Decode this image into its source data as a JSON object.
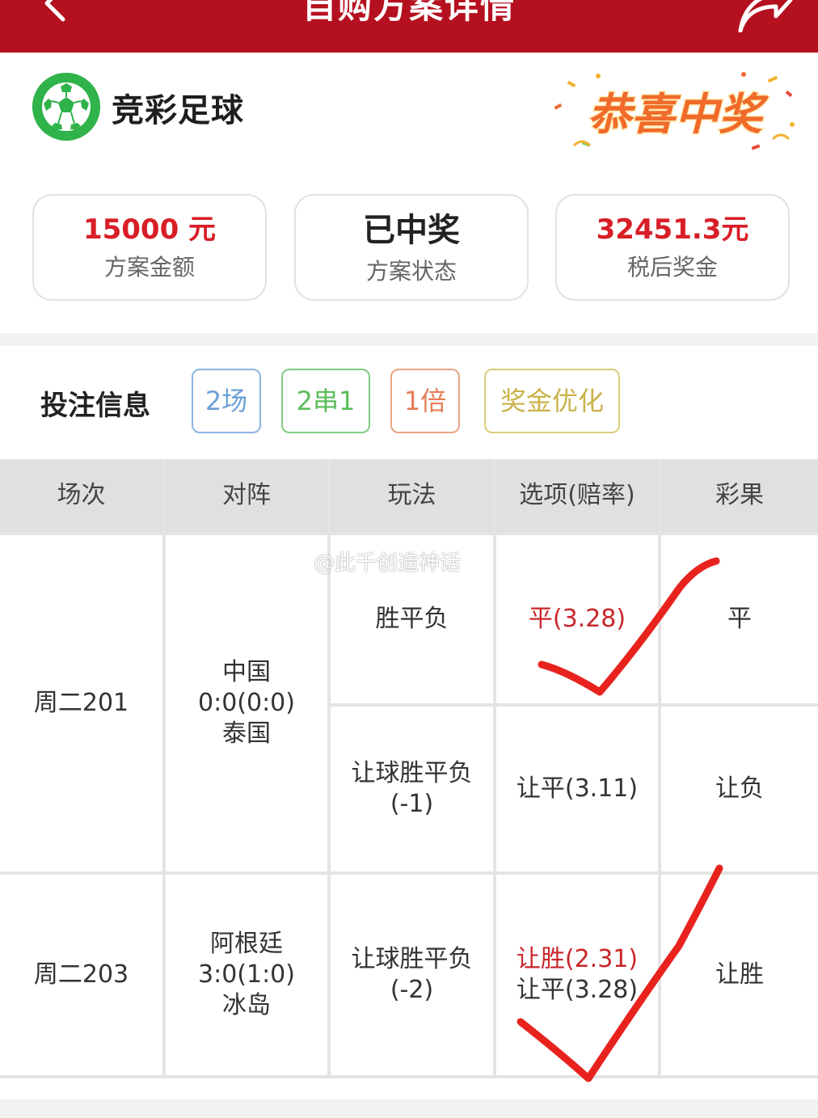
{
  "header": {
    "title": "自购方案详情",
    "back_icon": "chevron-left-icon",
    "share_icon": "share-arrow-icon",
    "background_color": "#b5101f"
  },
  "lottery": {
    "name": "竞彩足球",
    "logo_icon": "soccer-ball-icon",
    "logo_color": "#2fb34a",
    "banner_text": "恭喜中奖"
  },
  "summary": {
    "amount_value": "15000 元",
    "amount_label": "方案金额",
    "status_value": "已中奖",
    "status_label": "方案状态",
    "prize_value": "32451.3元",
    "prize_label": "税后奖金",
    "accent_color": "#d81e26"
  },
  "bet_info": {
    "title": "投注信息",
    "tags": [
      "2场",
      "2串1",
      "1倍",
      "奖金优化"
    ]
  },
  "table": {
    "headers": [
      "场次",
      "对阵",
      "玩法",
      "选项(赔率)",
      "彩果"
    ],
    "matches": [
      {
        "session": "周二201",
        "home": "中国",
        "score": "0:0(0:0)",
        "away": "泰国",
        "bets": [
          {
            "play": "胜平负",
            "options": [
              "平(3.28)"
            ],
            "result": "平"
          },
          {
            "play_line1": "让球胜平负",
            "play_line2": "(-1)",
            "options": [
              "让平(3.11)"
            ],
            "result": "让负"
          }
        ]
      },
      {
        "session": "周二203",
        "home": "阿根廷",
        "score": "3:0(1:0)",
        "away": "冰岛",
        "bets": [
          {
            "play_line1": "让球胜平负",
            "play_line2": "(-2)",
            "options": [
              "让胜(2.31)",
              "让平(3.28)"
            ],
            "result": "让胜"
          }
        ]
      }
    ],
    "highlight_color": "#c8262a"
  },
  "watermark": "@此千创造神话"
}
